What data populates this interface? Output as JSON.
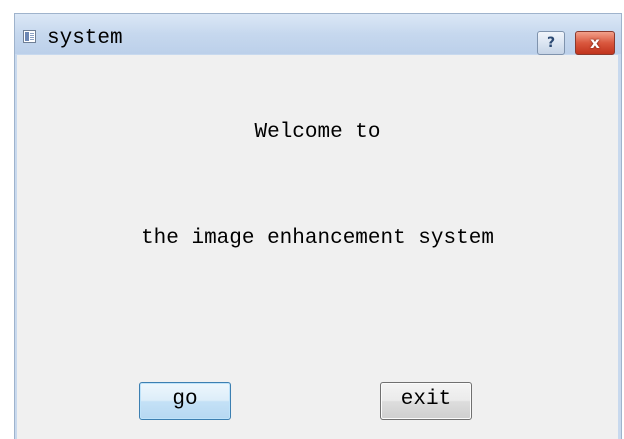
{
  "window": {
    "title": "system",
    "icon": "app-window-icon",
    "help_button_label": "?",
    "close_button_label": "x"
  },
  "content": {
    "welcome_line": "Welcome to",
    "system_line": "the image enhancement system"
  },
  "buttons": {
    "go_label": "go",
    "exit_label": "exit"
  },
  "colors": {
    "titlebar": "#c6d8ee",
    "client_background": "#f0f0f0",
    "close_button": "#d9573d",
    "go_button_focus_border": "#3c7fb1"
  }
}
